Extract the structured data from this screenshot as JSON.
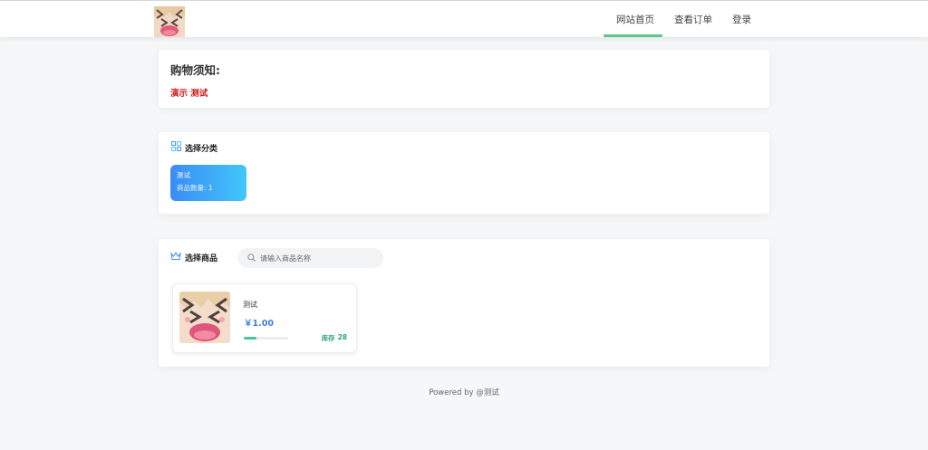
{
  "header": {
    "logo_name": "avatar-logo",
    "nav": [
      {
        "label": "网站首页",
        "active": true
      },
      {
        "label": "查看订单",
        "active": false
      },
      {
        "label": "登录",
        "active": false
      }
    ],
    "accent_color": "#5cc68b"
  },
  "notice": {
    "title": "购物须知:",
    "text": "演示 测试",
    "text_color": "#d01818"
  },
  "category": {
    "section_label": "选择分类",
    "icon": "grid-icon",
    "items": [
      {
        "name": "测试",
        "count_label": "商品数量:",
        "count": "1"
      }
    ]
  },
  "goods": {
    "section_label": "选择商品",
    "icon": "crown-icon",
    "search_placeholder": "请输入商品名称",
    "items": [
      {
        "name": "测试",
        "price": "￥1.00",
        "stock_label": "库存",
        "stock": "28",
        "stock_level": 0.28
      }
    ]
  },
  "footer": {
    "text": "Powered by @测试"
  }
}
